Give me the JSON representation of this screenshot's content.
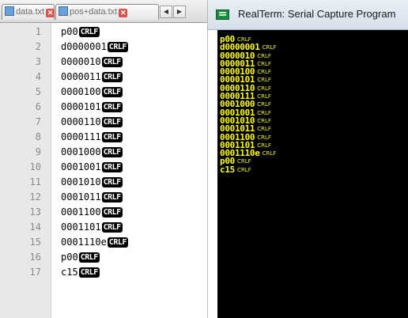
{
  "editor": {
    "tabs": [
      {
        "label": "data.txt"
      },
      {
        "label": "pos+data.txt"
      }
    ],
    "eol_marker": "CRLF",
    "lines": [
      {
        "num": "1",
        "text": "p00",
        "eol": true
      },
      {
        "num": "2",
        "text": "d0000001",
        "eol": true
      },
      {
        "num": "3",
        "text": "0000010",
        "eol": true
      },
      {
        "num": "4",
        "text": "0000011",
        "eol": true
      },
      {
        "num": "5",
        "text": "0000100",
        "eol": true
      },
      {
        "num": "6",
        "text": "0000101",
        "eol": true
      },
      {
        "num": "7",
        "text": "0000110",
        "eol": true
      },
      {
        "num": "8",
        "text": "0000111",
        "eol": true
      },
      {
        "num": "9",
        "text": "0001000",
        "eol": true
      },
      {
        "num": "10",
        "text": "0001001",
        "eol": true
      },
      {
        "num": "11",
        "text": "0001010",
        "eol": true
      },
      {
        "num": "12",
        "text": "0001011",
        "eol": true
      },
      {
        "num": "13",
        "text": "0001100",
        "eol": true
      },
      {
        "num": "14",
        "text": "0001101",
        "eol": true
      },
      {
        "num": "15",
        "text": "0001110e",
        "eol": true
      },
      {
        "num": "16",
        "text": "p00",
        "eol": true
      },
      {
        "num": "17",
        "text": "c15",
        "eol": true
      }
    ]
  },
  "realterm": {
    "title": "RealTerm: Serial Capture Program",
    "control_marker": "CRLF",
    "lines": [
      "p00",
      "d0000001",
      "0000010",
      "0000011",
      "0000100",
      "0000101",
      "0000110",
      "0000111",
      "0001000",
      "0001001",
      "0001010",
      "0001011",
      "0001100",
      "0001101",
      "0001110e",
      "p00",
      "c15"
    ]
  },
  "colors": {
    "terminal_bg": "#000000",
    "terminal_text": "#ffff00",
    "eol_badge_bg": "#000000"
  }
}
